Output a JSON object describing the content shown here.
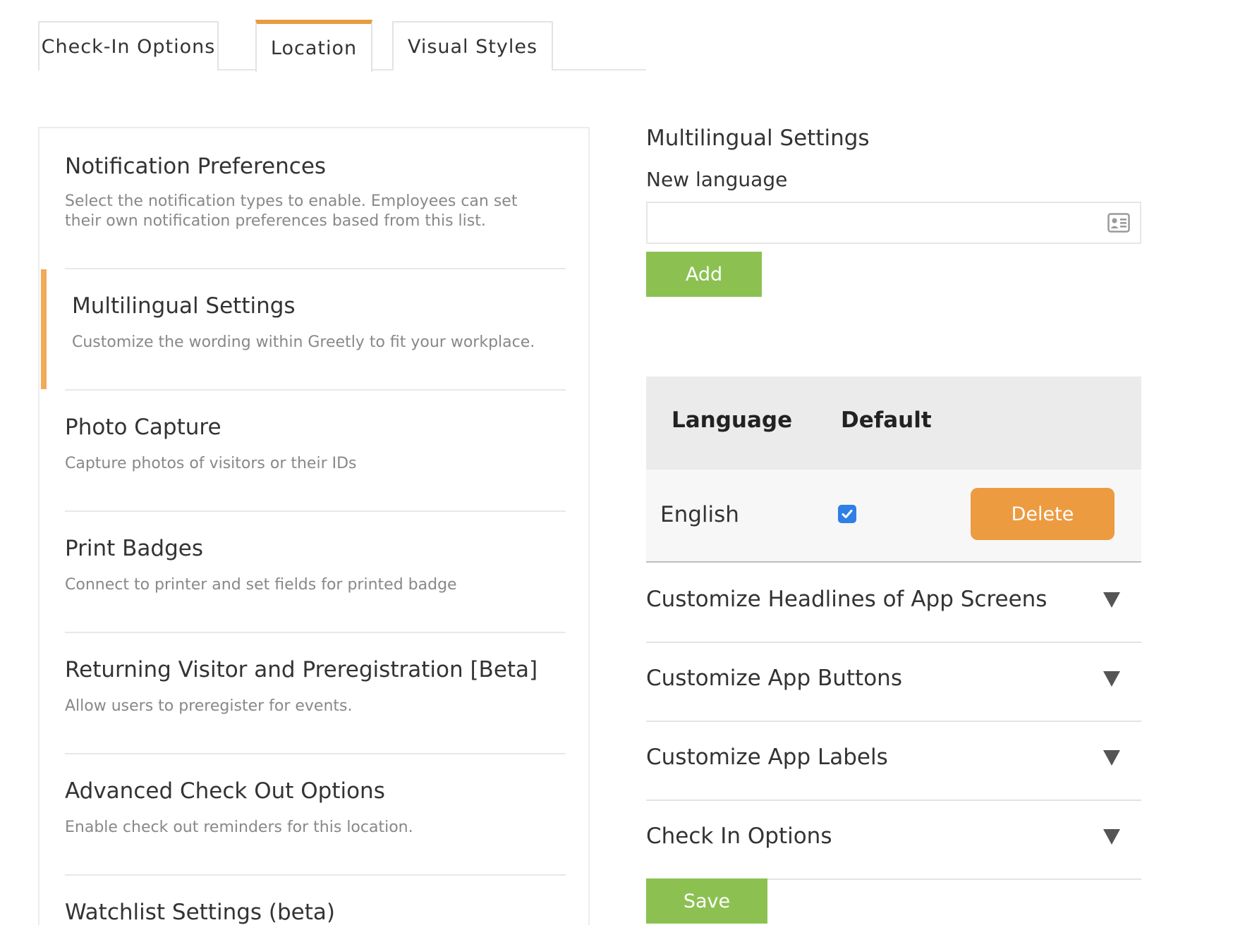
{
  "tabs": [
    {
      "label": "Check-In Options",
      "active": false
    },
    {
      "label": "Location",
      "active": true
    },
    {
      "label": "Visual Styles",
      "active": false
    }
  ],
  "sidebar": {
    "items": [
      {
        "title": "Notification Preferences",
        "description": "Select the notification types to enable. Employees can set their own notification preferences based from this list."
      },
      {
        "title": "Multilingual Settings",
        "description": "Customize the wording within Greetly to fit your workplace.",
        "active": true
      },
      {
        "title": "Photo Capture",
        "description": "Capture photos of visitors or their IDs"
      },
      {
        "title": "Print Badges",
        "description": "Connect to printer and set fields for printed badge"
      },
      {
        "title": "Returning Visitor and Preregistration [Beta]",
        "description": "Allow users to preregister for events."
      },
      {
        "title": "Advanced Check Out Options",
        "description": "Enable check out reminders for this location."
      },
      {
        "title": "Watchlist Settings (beta)",
        "description": ""
      }
    ]
  },
  "main": {
    "title": "Multilingual Settings",
    "new_language_label": "New language",
    "new_language_value": "",
    "new_language_placeholder": "",
    "add_label": "Add",
    "table": {
      "headers": [
        "Language",
        "Default"
      ],
      "rows": [
        {
          "language": "English",
          "default": true,
          "delete_label": "Delete"
        }
      ]
    },
    "accordions": [
      {
        "label": "Customize Headlines of App Screens"
      },
      {
        "label": "Customize App Buttons"
      },
      {
        "label": "Customize App Labels"
      },
      {
        "label": "Check In Options"
      }
    ],
    "save_label": "Save"
  },
  "colors": {
    "accent": "#ea9a42",
    "green": "#8cc152",
    "checkbox": "#2f7fe8"
  }
}
